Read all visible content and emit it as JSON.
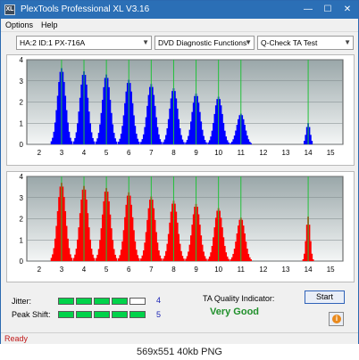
{
  "window": {
    "title": "PlexTools Professional XL V3.16",
    "icon_label": "XL",
    "controls": {
      "minimize": "—",
      "maximize": "☐",
      "close": "✕"
    }
  },
  "menu": {
    "options_label": "Options",
    "help_label": "Help"
  },
  "toolbar": {
    "drive_select": "HA:2 ID:1  PX-716A",
    "function_select": "DVD Diagnostic Functions",
    "test_select": "Q-Check TA Test"
  },
  "colors": {
    "title_bar": "#2b6fb6",
    "top_chart_bars": "#0000ff",
    "bottom_chart_bars": "#ff0000",
    "green_markers": "#22c03a",
    "meter_on": "#00d34a",
    "quality_good": "#1f8f2a",
    "status_red": "#c01818"
  },
  "charts": [
    {
      "name": "top",
      "bar_color": "#0000ff",
      "y_ticks": [
        "0",
        "0.5",
        "1",
        "1.5",
        "2",
        "2.5",
        "3",
        "3.5",
        "4"
      ],
      "x_ticks": [
        "2",
        "3",
        "4",
        "5",
        "6",
        "7",
        "8",
        "9",
        "10",
        "11",
        "12",
        "13",
        "14",
        "15"
      ],
      "peaks": [
        {
          "x": 3,
          "height": 3.6
        },
        {
          "x": 4,
          "height": 3.45
        },
        {
          "x": 5,
          "height": 3.3
        },
        {
          "x": 6,
          "height": 3.05
        },
        {
          "x": 7,
          "height": 2.85
        },
        {
          "x": 8,
          "height": 2.65
        },
        {
          "x": 9,
          "height": 2.4
        },
        {
          "x": 10,
          "height": 2.25
        },
        {
          "x": 11,
          "height": 1.45
        },
        {
          "x": 14,
          "height": 1.0
        }
      ]
    },
    {
      "name": "bottom",
      "bar_color": "#ff0000",
      "y_ticks": [
        "0",
        "0.5",
        "1",
        "1.5",
        "2",
        "2.5",
        "3",
        "3.5",
        "4"
      ],
      "x_ticks": [
        "2",
        "3",
        "4",
        "5",
        "6",
        "7",
        "8",
        "9",
        "10",
        "11",
        "12",
        "13",
        "14",
        "15"
      ],
      "peaks": [
        {
          "x": 3,
          "height": 3.7
        },
        {
          "x": 4,
          "height": 3.55
        },
        {
          "x": 5,
          "height": 3.45
        },
        {
          "x": 6,
          "height": 3.25
        },
        {
          "x": 7,
          "height": 3.05
        },
        {
          "x": 8,
          "height": 2.85
        },
        {
          "x": 9,
          "height": 2.7
        },
        {
          "x": 10,
          "height": 2.5
        },
        {
          "x": 11,
          "height": 2.05
        },
        {
          "x": 14,
          "height": 2.1
        }
      ]
    }
  ],
  "metrics": {
    "jitter_label": "Jitter:",
    "jitter_value": "4",
    "jitter_level": 4,
    "peak_shift_label": "Peak Shift:",
    "peak_shift_value": "5",
    "peak_shift_level": 5,
    "meter_segments": 5
  },
  "quality": {
    "label": "TA Quality Indicator:",
    "value": "Very Good"
  },
  "buttons": {
    "start_label": "Start",
    "info_icon": "info-icon"
  },
  "status": {
    "text": "Ready"
  },
  "caption": "569x551  40kb  PNG"
}
